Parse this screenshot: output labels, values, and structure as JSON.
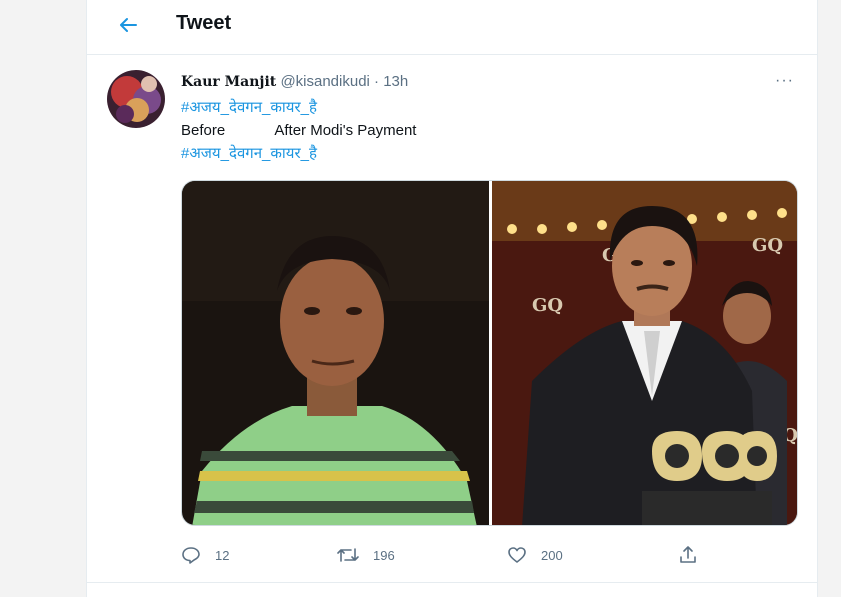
{
  "header": {
    "title": "Tweet"
  },
  "tweet": {
    "author": "Kaur Manjit",
    "handle": "@kisandikudi",
    "separator": "·",
    "time": "13h",
    "more": "···",
    "hashtag_1": "#अजय_देवगन_कायर_है",
    "caption": "Before            After Modi's Payment",
    "hashtag_2": "#अजय_देवगन_कायर_है",
    "image_text": "GQ",
    "stats": {
      "replies": "12",
      "retweets": "196",
      "likes": "200"
    }
  },
  "colors": {
    "accent": "#1b95e0",
    "muted": "#5b7083",
    "border": "#e6ecf0"
  },
  "icons": [
    "back-arrow-icon",
    "more-icon",
    "reply-icon",
    "retweet-icon",
    "like-icon",
    "share-icon"
  ]
}
